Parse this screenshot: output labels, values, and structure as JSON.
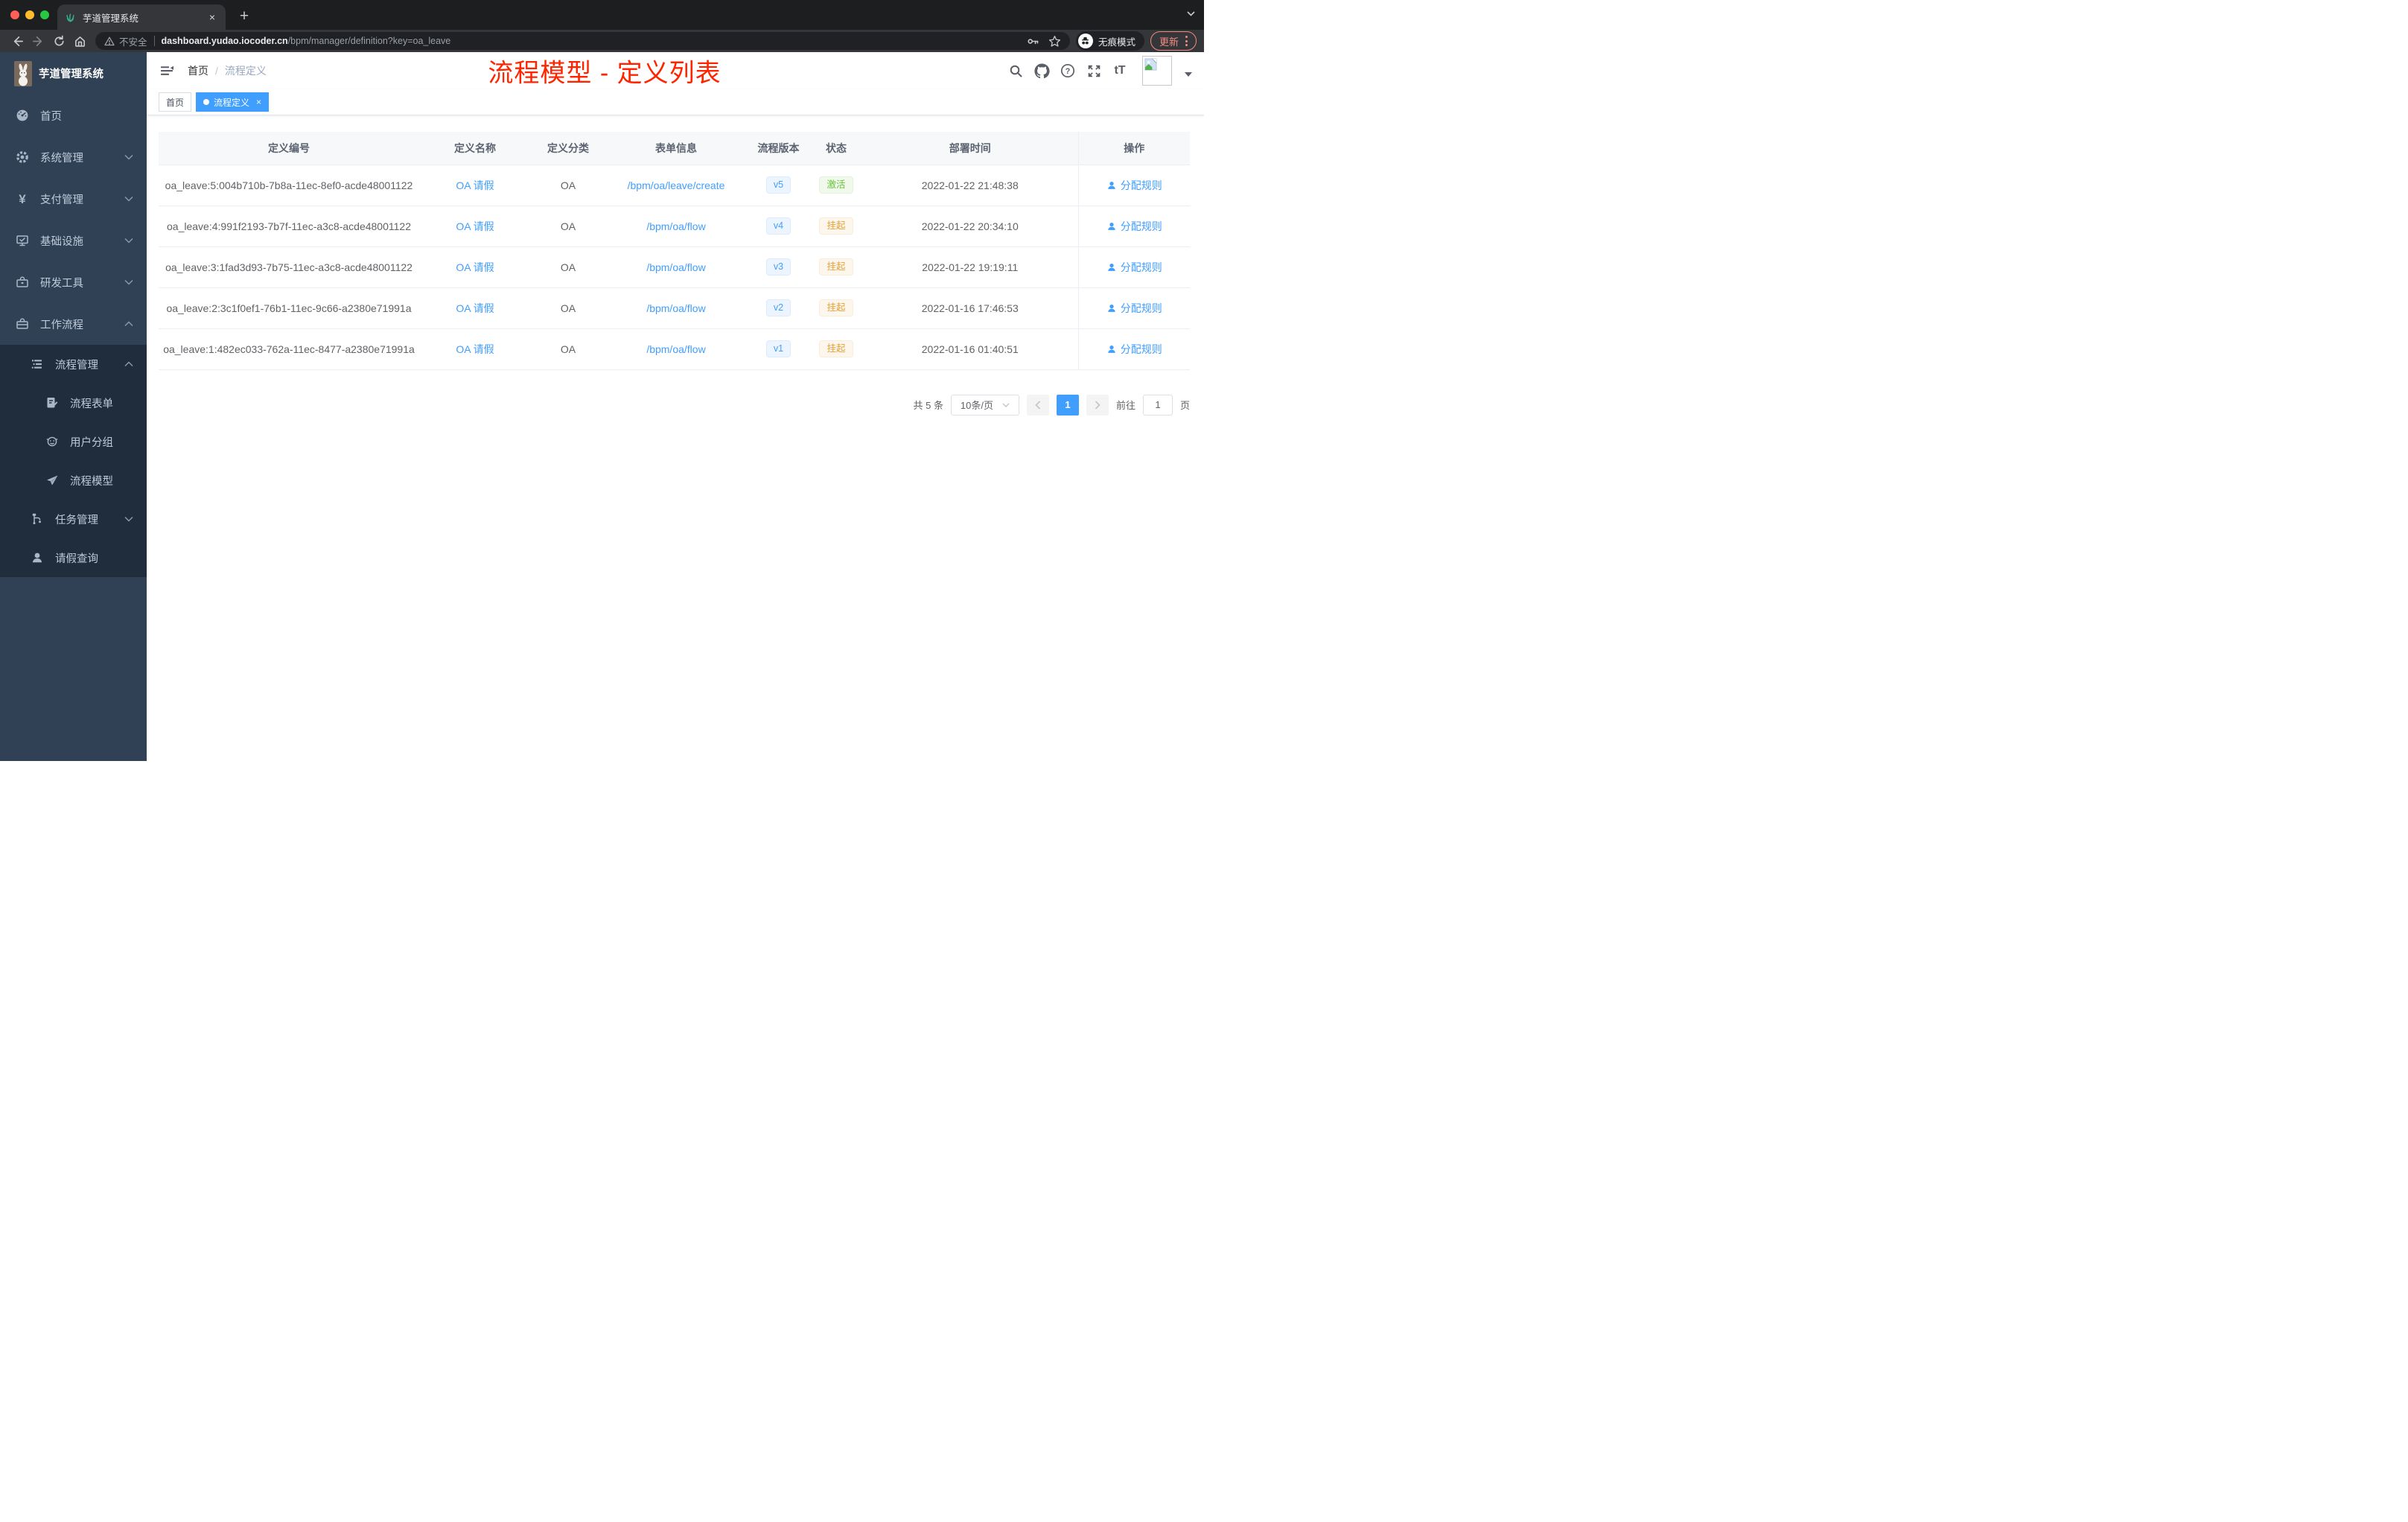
{
  "browser": {
    "tab_title": "芋道管理系统",
    "url": {
      "security": "不安全",
      "domain": "dashboard.yudao.iocoder.cn",
      "path": "/bpm/manager/definition?key=oa_leave"
    },
    "incognito_label": "无痕模式",
    "update_label": "更新"
  },
  "icons": {
    "close": "×",
    "new_tab": "+",
    "yen": "¥",
    "text_size": "tT"
  },
  "sidebar": {
    "title": "芋道管理系统",
    "menu": [
      {
        "label": "首页"
      },
      {
        "label": "系统管理"
      },
      {
        "label": "支付管理"
      },
      {
        "label": "基础设施"
      },
      {
        "label": "研发工具"
      },
      {
        "label": "工作流程"
      }
    ],
    "submenu": [
      {
        "label": "流程管理"
      },
      {
        "label": "流程表单"
      },
      {
        "label": "用户分组"
      },
      {
        "label": "流程模型"
      },
      {
        "label": "任务管理"
      },
      {
        "label": "请假查询"
      }
    ]
  },
  "header": {
    "breadcrumb_home": "首页",
    "breadcrumb_sep": "/",
    "breadcrumb_current": "流程定义",
    "annotation": "流程模型 - 定义列表",
    "annotation_color": "#ff2400"
  },
  "tags": {
    "home_label": "首页",
    "active_label": "流程定义"
  },
  "table": {
    "columns": [
      "定义编号",
      "定义名称",
      "定义分类",
      "表单信息",
      "流程版本",
      "状态",
      "部署时间",
      "操作"
    ],
    "rows": [
      {
        "id": "oa_leave:5:004b710b-7b8a-11ec-8ef0-acde48001122",
        "name": "OA 请假",
        "category": "OA",
        "form": "/bpm/oa/leave/create",
        "version": "v5",
        "status": "激活",
        "status_type": "success",
        "deploy_time": "2022-01-22 21:48:38",
        "action": "分配规则"
      },
      {
        "id": "oa_leave:4:991f2193-7b7f-11ec-a3c8-acde48001122",
        "name": "OA 请假",
        "category": "OA",
        "form": "/bpm/oa/flow",
        "version": "v4",
        "status": "挂起",
        "status_type": "warning",
        "deploy_time": "2022-01-22 20:34:10",
        "action": "分配规则"
      },
      {
        "id": "oa_leave:3:1fad3d93-7b75-11ec-a3c8-acde48001122",
        "name": "OA 请假",
        "category": "OA",
        "form": "/bpm/oa/flow",
        "version": "v3",
        "status": "挂起",
        "status_type": "warning",
        "deploy_time": "2022-01-22 19:19:11",
        "action": "分配规则"
      },
      {
        "id": "oa_leave:2:3c1f0ef1-76b1-11ec-9c66-a2380e71991a",
        "name": "OA 请假",
        "category": "OA",
        "form": "/bpm/oa/flow",
        "version": "v2",
        "status": "挂起",
        "status_type": "warning",
        "deploy_time": "2022-01-16 17:46:53",
        "action": "分配规则"
      },
      {
        "id": "oa_leave:1:482ec033-762a-11ec-8477-a2380e71991a",
        "name": "OA 请假",
        "category": "OA",
        "form": "/bpm/oa/flow",
        "version": "v1",
        "status": "挂起",
        "status_type": "warning",
        "deploy_time": "2022-01-16 01:40:51",
        "action": "分配规则"
      }
    ]
  },
  "pagination": {
    "total": "共 5 条",
    "page_size": "10条/页",
    "page": "1",
    "goto_prefix": "前往",
    "goto_value": "1",
    "goto_suffix": "页"
  },
  "colors": {
    "accent": "#409eff",
    "success": "#67c23a",
    "warning": "#e6a23c"
  }
}
